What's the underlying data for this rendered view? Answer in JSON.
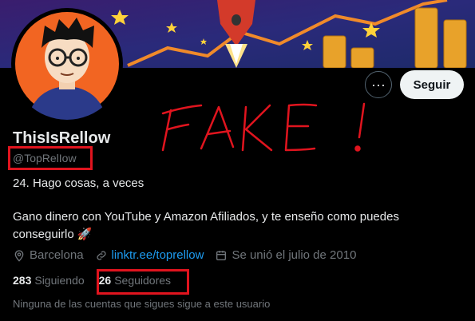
{
  "profile": {
    "name": "ThisIsRellow",
    "handle": "@TopRelIow",
    "bio_line1": "24. Hago cosas, a veces",
    "bio_line2": "Gano dinero con YouTube y Amazon Afiliados, y te enseño como puedes conseguirlo 🚀",
    "location": "Barcelona",
    "link": "linktr.ee/toprellow",
    "joined": "Se unió el julio de 2010",
    "following_count": "283",
    "following_label": "Siguiendo",
    "followers_count": "26",
    "followers_label": "Seguidores",
    "mutuals_note": "Ninguna de las cuentas que sigues sigue a este usuario"
  },
  "actions": {
    "more_label": "···",
    "follow_label": "Seguir"
  },
  "annotation": {
    "text": "FAKE !",
    "color": "#e0141e"
  },
  "icons": {
    "location": "location-pin-icon",
    "link": "link-icon",
    "calendar": "calendar-icon",
    "banner_rocket": "rocket-icon",
    "banner_star": "star-icon"
  },
  "colors": {
    "background": "#000000",
    "accent_link": "#1d9bf0",
    "muted_text": "#71767b",
    "annotation_red": "#e0141e",
    "avatar_bg": "#f26522"
  }
}
